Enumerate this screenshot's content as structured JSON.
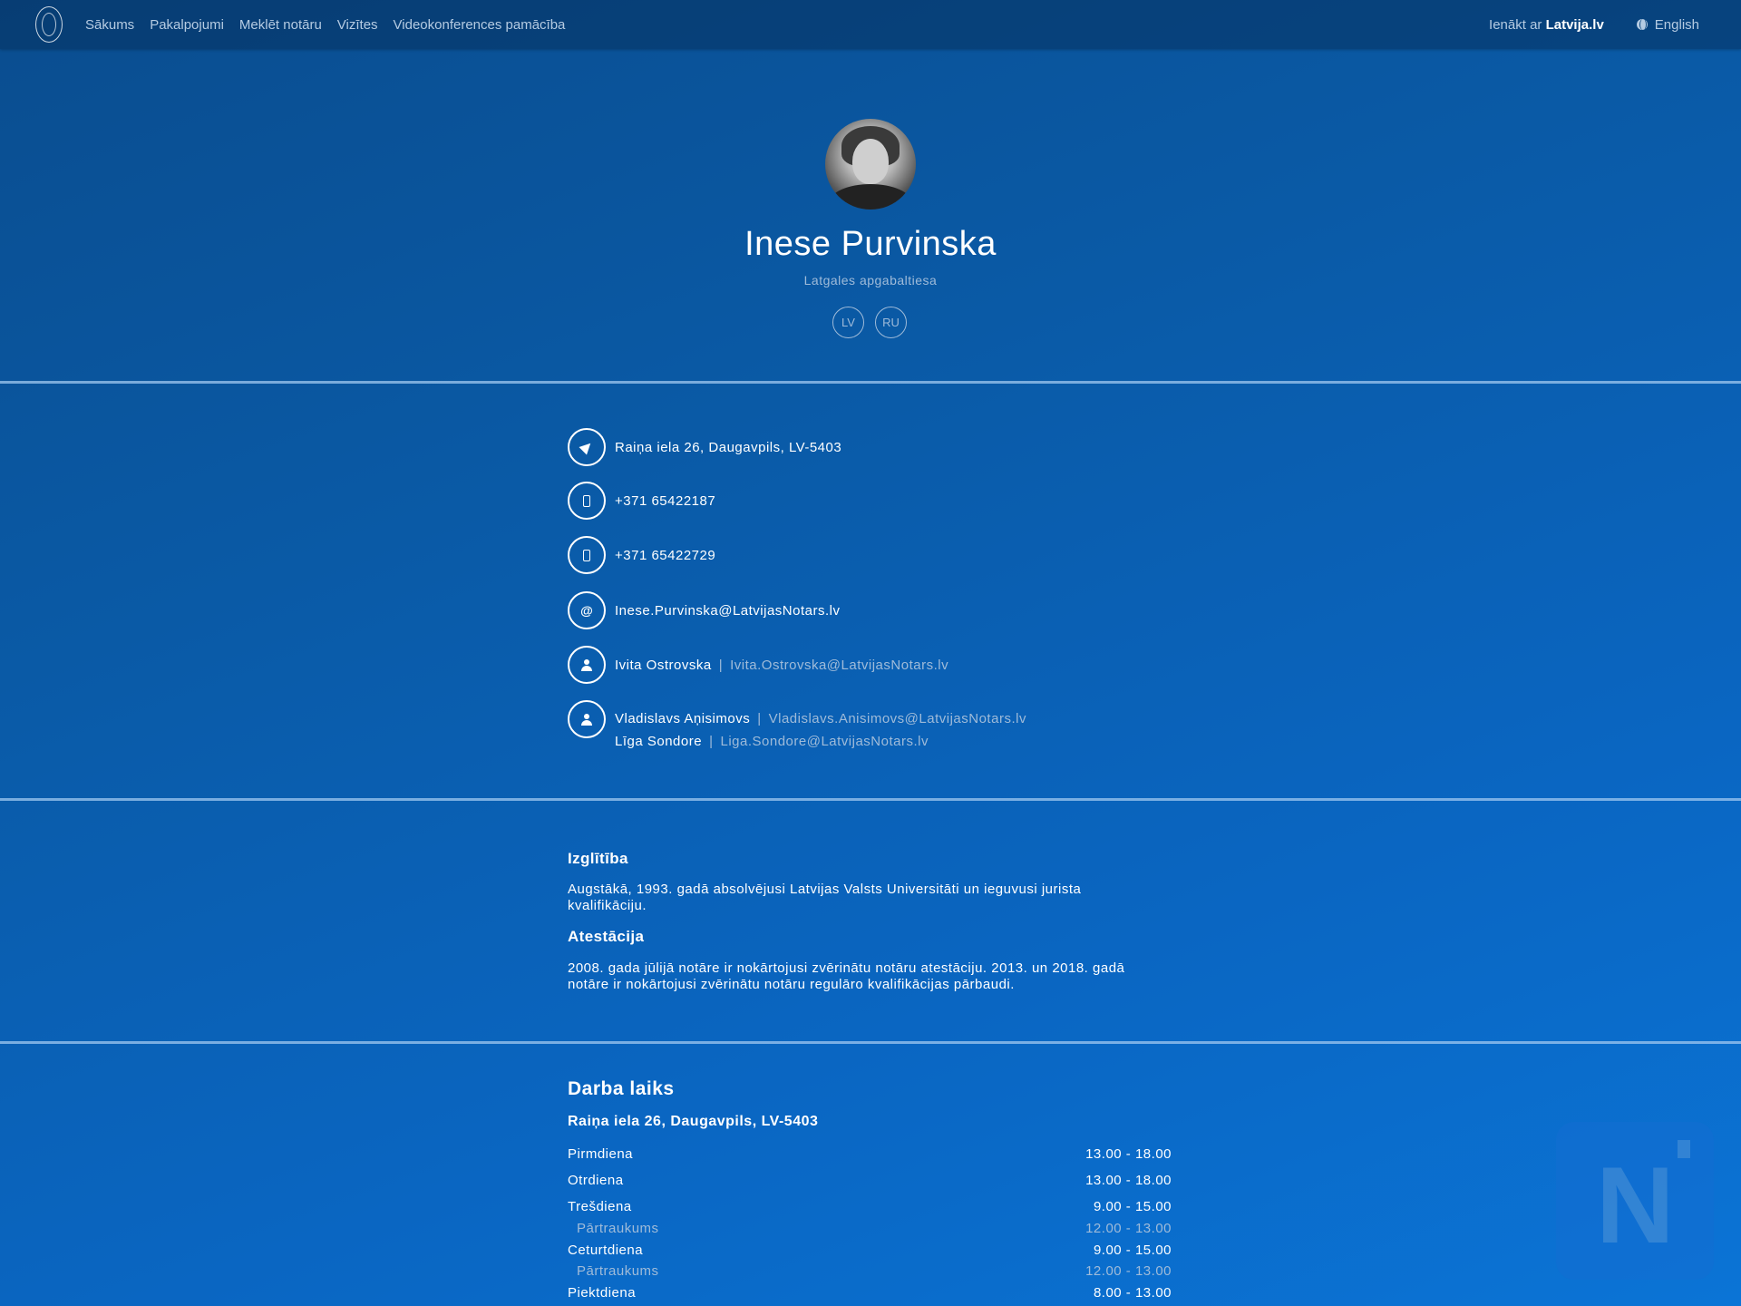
{
  "nav": {
    "items": [
      "Sākums",
      "Pakalpojumi",
      "Meklēt notāru",
      "Vizītes",
      "Videokonferences pamācība"
    ],
    "login_prefix": "Ienākt ar",
    "login_brand": "Latvija.lv",
    "language": "English"
  },
  "profile": {
    "name": "Inese Purvinska",
    "court": "Latgales apgabaltiesa",
    "languages": [
      "LV",
      "RU"
    ]
  },
  "contact": {
    "address": "Raiņa iela 26, Daugavpils, LV-5403",
    "phone1": "+371 65422187",
    "phone2": "+371 65422729",
    "email": "Inese.Purvinska@LatvijasNotars.lv",
    "assistants": [
      {
        "name": "Ivita Ostrovska",
        "email": "Ivita.Ostrovska@LatvijasNotars.lv"
      },
      {
        "name": "Vladislavs Aņisimovs",
        "email": "Vladislavs.Anisimovs@LatvijasNotars.lv"
      },
      {
        "name": "Līga Sondore",
        "email": "Liga.Sondore@LatvijasNotars.lv"
      }
    ]
  },
  "education": {
    "heading": "Izglītība",
    "text": "Augstākā, 1993. gadā absolvējusi Latvijas Valsts Universitāti un ieguvusi jurista kvalifikāciju."
  },
  "attestation": {
    "heading": "Atestācija",
    "text": "2008. gada jūlijā notāre ir nokārtojusi zvērinātu notāru atestāciju. 2013. un 2018. gadā notāre ir nokārtojusi zvērinātu notāru regulāro kvalifikācijas pārbaudi."
  },
  "hours": {
    "title": "Darba laiks",
    "address": "Raiņa iela 26, Daugavpils, LV-5403",
    "rows": [
      {
        "day": "Pirmdiena",
        "time": "13.00 - 18.00"
      },
      {
        "day": "Otrdiena",
        "time": "13.00 - 18.00"
      },
      {
        "day": "Trešdiena",
        "time": "9.00 - 15.00"
      },
      {
        "day": "Pārtraukums",
        "time": "12.00 - 13.00"
      },
      {
        "day": "Ceturtdiena",
        "time": "9.00 - 15.00"
      },
      {
        "day": "Pārtraukums",
        "time": "12.00 - 13.00"
      },
      {
        "day": "Piektdiena",
        "time": "8.00 - 13.00"
      }
    ]
  },
  "watermark_letter": "N"
}
